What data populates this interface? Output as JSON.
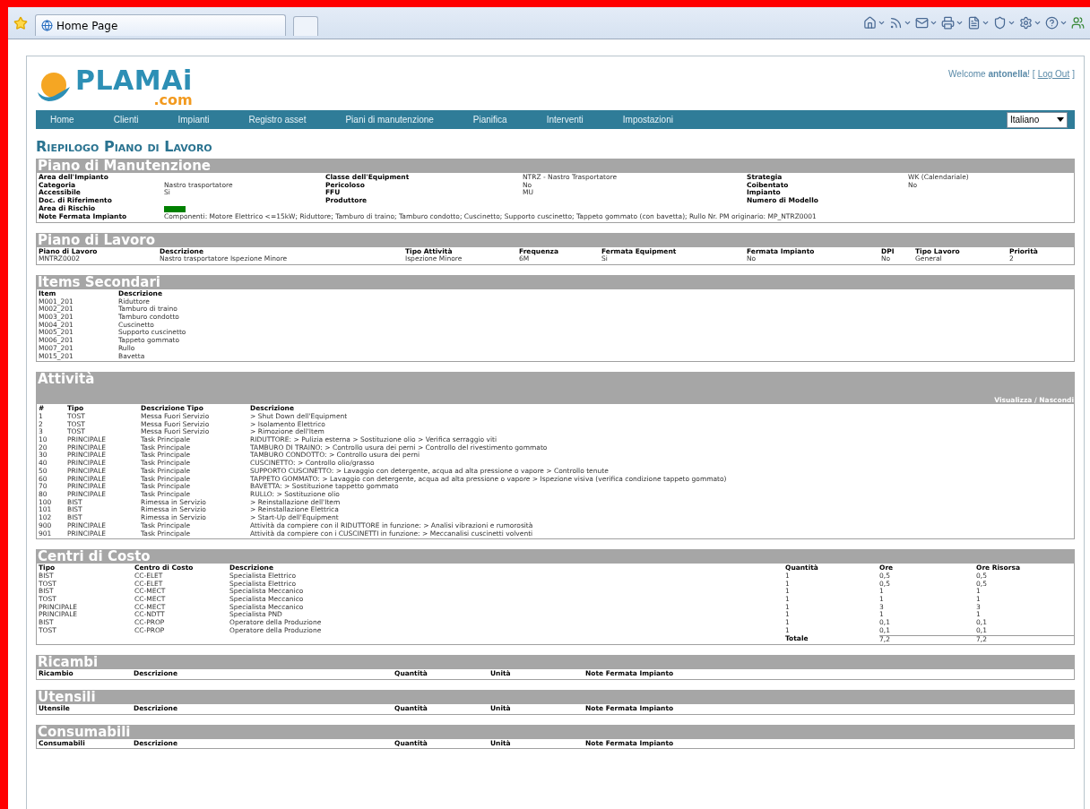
{
  "browser": {
    "tab_title": "Home Page"
  },
  "header": {
    "logo": {
      "name": "PLAMAi",
      "suffix": ".com"
    },
    "welcome": "Welcome **antonella**! [",
    "logout": "Log Out",
    "welcome_end": "]"
  },
  "nav": {
    "items": [
      "Home",
      "Clienti",
      "Impianti",
      "Registro asset",
      "Piani di manutenzione",
      "Pianifica",
      "Interventi",
      "Impostazioni"
    ],
    "language": "Italiano"
  },
  "page_title": "Riepilogo Piano di Lavoro",
  "maintenance_plan": {
    "title": "Piano di Manutenzione",
    "rows": [
      [
        {
          "label": "Area dell'Impianto"
        },
        {
          "label": "Classe dell'Equipment",
          "value": "NTRZ - Nastro Trasportatore"
        },
        {
          "label": "Strategia",
          "value": "WK (Calendariale)"
        }
      ],
      [
        {
          "label": "Categoria",
          "value": "Nastro trasportatore"
        },
        {
          "label": "Pericoloso",
          "value": "No"
        },
        {
          "label": "Coibentato",
          "value": "No"
        }
      ],
      [
        {
          "label": "Accessibile",
          "value": "Si"
        },
        {
          "label": "FFU",
          "value": "MU"
        },
        {
          "label": "Impianto"
        }
      ],
      [
        {
          "label": "Doc. di Riferimento"
        },
        {
          "label": "Produttore"
        },
        {
          "label": "Numero di Modello"
        }
      ]
    ],
    "risk_area": {
      "label": "Area di Rischio",
      "color": "#008000"
    },
    "notes": {
      "label": "Note Fermata Impianto",
      "value": "Componenti: Motore Elettrico <=15kW; Riduttore; Tamburo di traino; Tamburo condotto; Cuscinetto; Supporto cuscinetto; Tappeto gommato (con bavetta); Rullo Nr. PM originario: MP_NTRZ0001"
    }
  },
  "sections": [
    {
      "title": "Piano di Lavoro",
      "columns": [
        "Piano di Lavoro",
        "Descrizione",
        "Tipo Attività",
        "Frequenza",
        "Fermata Equipment",
        "Fermata Impianto",
        "DPI",
        "Tipo Lavoro",
        "Priorità"
      ],
      "rows": [
        [
          "MNTRZ0002",
          "Nastro trasportatore Ispezione Minore",
          "Ispezione Minore",
          "6M",
          "Si",
          "No",
          "No",
          "General",
          "2"
        ]
      ]
    },
    {
      "title": "Items Secondari",
      "columns": [
        "Item",
        "Descrizione"
      ],
      "rows": [
        [
          "M001_201",
          "Riduttore"
        ],
        [
          "M002_201",
          "Tamburo di traino"
        ],
        [
          "M003_201",
          "Tamburo condotto"
        ],
        [
          "M004_201",
          "Cuscinetto"
        ],
        [
          "M005_201",
          "Supporto cuscinetto"
        ],
        [
          "M006_201",
          "Tappeto gommato"
        ],
        [
          "M007_201",
          "Rullo"
        ],
        [
          "M015_201",
          "Bavetta"
        ]
      ]
    },
    {
      "title": "Attività",
      "toggle_link": "Visualizza / Nascondi",
      "columns": [
        "#",
        "Tipo",
        "Descrizione Tipo",
        "Descrizione"
      ],
      "rows": [
        [
          "1",
          "TOST",
          "Messa Fuori Servizio",
          "> Shut Down dell'Equipment"
        ],
        [
          "2",
          "TOST",
          "Messa Fuori Servizio",
          "> Isolamento Elettrico"
        ],
        [
          "3",
          "TOST",
          "Messa Fuori Servizio",
          "> Rimozione dell'Item"
        ],
        [
          "10",
          "PRINCIPALE",
          "Task Principale",
          "RIDUTTORE: > Pulizia esterna > Sostituzione olio > Verifica serraggio viti"
        ],
        [
          "20",
          "PRINCIPALE",
          "Task Principale",
          "TAMBURO DI TRAINO: > Controllo usura dei perni > Controllo del rivestimento gommato"
        ],
        [
          "30",
          "PRINCIPALE",
          "Task Principale",
          "TAMBURO CONDOTTO: > Controllo usura dei perni"
        ],
        [
          "40",
          "PRINCIPALE",
          "Task Principale",
          "CUSCINETTO: > Controllo olio/grasso"
        ],
        [
          "50",
          "PRINCIPALE",
          "Task Principale",
          "SUPPORTO CUSCINETTO: > Lavaggio con detergente, acqua ad alta pressione o vapore > Controllo tenute"
        ],
        [
          "60",
          "PRINCIPALE",
          "Task Principale",
          "TAPPETO GOMMATO: > Lavaggio con detergente, acqua ad alta pressione o vapore > Ispezione visiva (verifica condizione tappeto gommato)"
        ],
        [
          "70",
          "PRINCIPALE",
          "Task Principale",
          "BAVETTA: > Sostituzione tappetto gommato"
        ],
        [
          "80",
          "PRINCIPALE",
          "Task Principale",
          "RULLO: > Sostituzione olio"
        ],
        [
          "100",
          "BIST",
          "Rimessa in Servizio",
          "> Reinstallazione dell'Item"
        ],
        [
          "101",
          "BIST",
          "Rimessa in Servizio",
          "> Reinstallazione Elettrica"
        ],
        [
          "102",
          "BIST",
          "Rimessa in Servizio",
          "> Start-Up dell'Equipment"
        ],
        [
          "900",
          "PRINCIPALE",
          "Task Principale",
          "Attività da compiere con il RIDUTTORE in funzione: > Analisi vibrazioni e rumorosità"
        ],
        [
          "901",
          "PRINCIPALE",
          "Task Principale",
          "Attività da compiere con i CUSCINETTI in funzione: > Meccanalisi cuscinetti volventi"
        ]
      ]
    },
    {
      "title": "Centri di Costo",
      "columns": [
        "Tipo",
        "Centro di Costo",
        "Descrizione",
        "Quantità",
        "Ore",
        "Ore Risorsa"
      ],
      "rows": [
        [
          "BIST",
          "CC-ELET",
          "Specialista Elettrico",
          "1",
          "0,5",
          "0,5"
        ],
        [
          "TOST",
          "CC-ELET",
          "Specialista Elettrico",
          "1",
          "0,5",
          "0,5"
        ],
        [
          "BIST",
          "CC-MECT",
          "Specialista Meccanico",
          "1",
          "1",
          "1"
        ],
        [
          "TOST",
          "CC-MECT",
          "Specialista Meccanico",
          "1",
          "1",
          "1"
        ],
        [
          "PRINCIPALE",
          "CC-MECT",
          "Specialista Meccanico",
          "1",
          "3",
          "3"
        ],
        [
          "PRINCIPALE",
          "CC-NDTT",
          "Specialista PND",
          "1",
          "1",
          "1"
        ],
        [
          "BIST",
          "CC-PROP",
          "Operatore della Produzione",
          "1",
          "0,1",
          "0,1"
        ],
        [
          "TOST",
          "CC-PROP",
          "Operatore della Produzione",
          "1",
          "0,1",
          "0,1"
        ]
      ],
      "total": {
        "label": "Totale",
        "values": [
          "7,2",
          "7,2"
        ]
      }
    },
    {
      "title": "Ricambi",
      "columns": [
        "Ricambio",
        "Descrizione",
        "Quantità",
        "Unità",
        "Note Fermata Impianto"
      ]
    },
    {
      "title": "Utensili",
      "columns": [
        "Utensile",
        "Descrizione",
        "Quantità",
        "Unità",
        "Note Fermata Impianto"
      ]
    },
    {
      "title": "Consumabili",
      "columns": [
        "Consumabili",
        "Descrizione",
        "Quantità",
        "Unità",
        "Note Fermata Impianto"
      ]
    }
  ]
}
